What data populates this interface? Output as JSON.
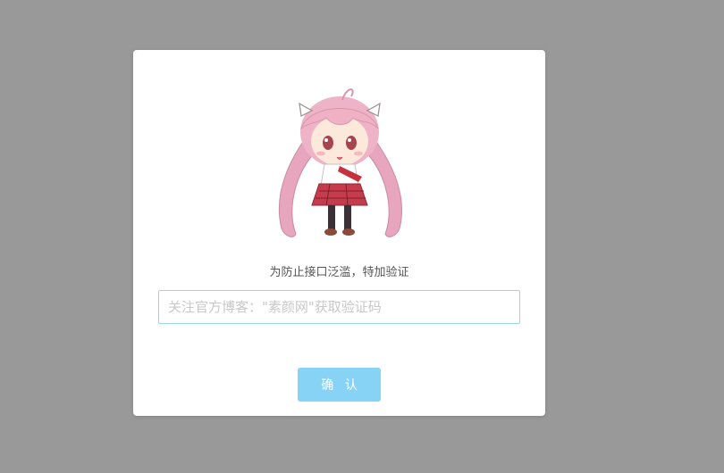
{
  "dialog": {
    "prompt": "为防止接口泛滥，特加验证",
    "input_placeholder": "关注官方博客：\"素颜网\"获取验证码",
    "input_value": "",
    "confirm_label": "确 认"
  },
  "colors": {
    "backdrop": "#999999",
    "dialog_bg": "#ffffff",
    "input_border": "#9ad8ef",
    "button_bg": "#87d3f5",
    "button_text": "#ffffff",
    "prompt_text": "#555555",
    "placeholder_text": "#c8c8c8"
  },
  "icons": {
    "mascot": "chibi-girl-mascot-illustration"
  }
}
